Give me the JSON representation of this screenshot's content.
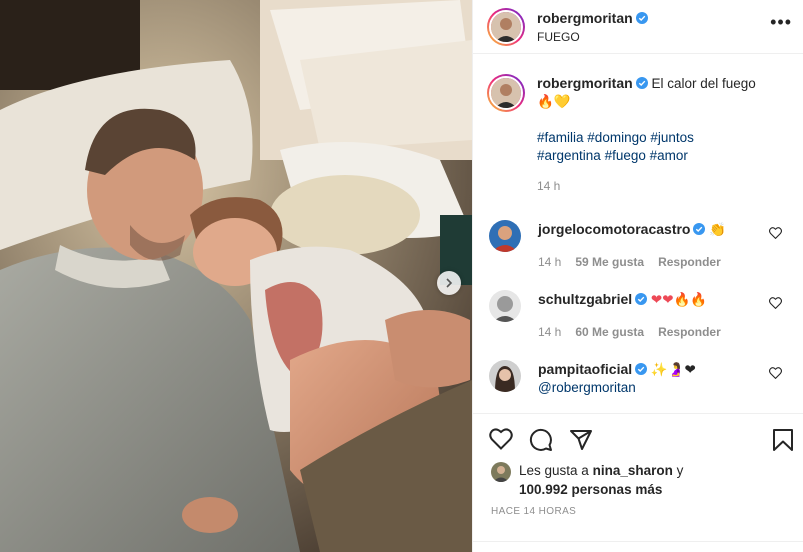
{
  "post": {
    "author": "robergmoritan",
    "location": "FUEGO",
    "caption_text": "El calor del fuego",
    "caption_emoji": "🔥💛",
    "hashtags": [
      "#familia",
      "#domingo",
      "#juntos",
      "#argentina",
      "#fuego",
      "#amor"
    ],
    "time": "14 h"
  },
  "comments": [
    {
      "user": "jorgelocomotoracastro",
      "text": "👏",
      "time": "14 h",
      "likes": "59 Me gusta",
      "reply": "Responder",
      "avatar_color": "#c0392b"
    },
    {
      "user": "schultzgabriel",
      "text": "❤❤🔥🔥",
      "time": "14 h",
      "likes": "60 Me gusta",
      "reply": "Responder",
      "avatar_color": "#9a9a9a"
    },
    {
      "user": "pampitaoficial",
      "text": "✨🤰❤",
      "mention": "@robergmoritan",
      "avatar_color": "#3a2a22"
    }
  ],
  "likes": {
    "prefix": "Les gusta a",
    "user": "nina_sharon",
    "suffix": "y",
    "count": "100.992 personas más"
  },
  "timestamp": "HACE 14 HORAS",
  "colors": {
    "link": "#00376b",
    "verified": "#3897f0",
    "muted": "#8e8e8e",
    "heart": "#ed4956"
  },
  "icons": {
    "like": "heart-icon",
    "comment": "comment-icon",
    "share": "paper-plane-icon",
    "save": "bookmark-icon",
    "more": "more-options-icon",
    "next": "chevron-right-icon"
  }
}
